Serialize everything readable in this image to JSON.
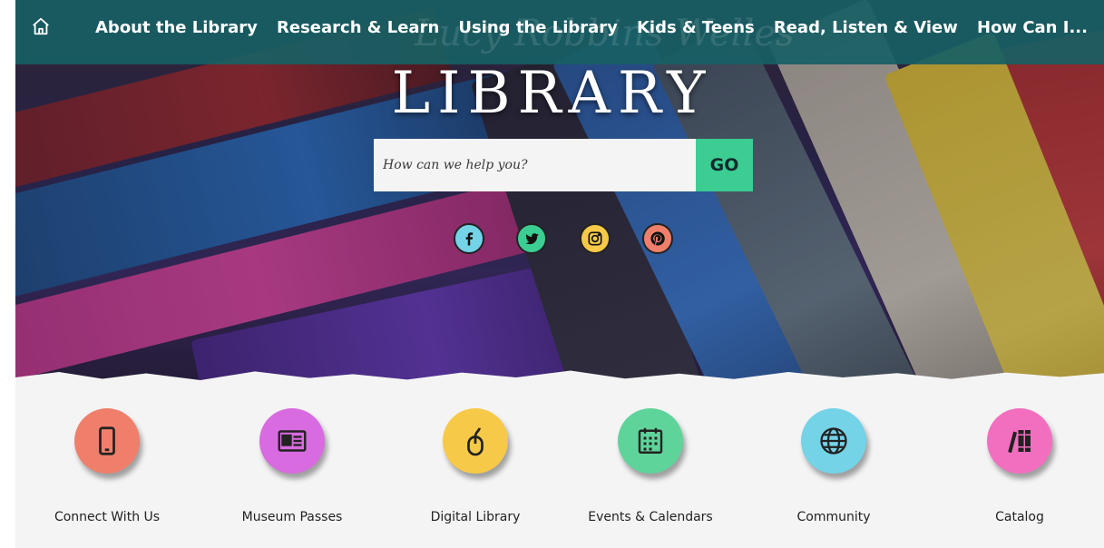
{
  "nav": {
    "home_icon": "home-icon",
    "items": [
      {
        "label": "About the Library"
      },
      {
        "label": "Research & Learn"
      },
      {
        "label": "Using the Library"
      },
      {
        "label": "Kids & Teens"
      },
      {
        "label": "Read, Listen & View"
      },
      {
        "label": "How Can I..."
      }
    ]
  },
  "hero": {
    "title": "LIBRARY",
    "watermark": "Lucy Robbins Welles"
  },
  "search": {
    "placeholder": "How can we help you?",
    "go_label": "GO"
  },
  "social": [
    {
      "icon": "facebook-icon",
      "color": "#74d3e6"
    },
    {
      "icon": "twitter-icon",
      "color": "#3ccd93"
    },
    {
      "icon": "instagram-icon",
      "color": "#f7c948"
    },
    {
      "icon": "pinterest-icon",
      "color": "#ef7f6b"
    }
  ],
  "quicklinks": [
    {
      "label": "Connect With Us",
      "icon": "phone-icon",
      "color": "#ef7f6b"
    },
    {
      "label": "Museum Passes",
      "icon": "id-card-icon",
      "color": "#d86be0"
    },
    {
      "label": "Digital Library",
      "icon": "mouse-icon",
      "color": "#f7c948"
    },
    {
      "label": "Events & Calendars",
      "icon": "calendar-icon",
      "color": "#5fd49a"
    },
    {
      "label": "Community",
      "icon": "globe-icon",
      "color": "#74d3e6"
    },
    {
      "label": "Catalog",
      "icon": "books-icon",
      "color": "#f26fbf"
    }
  ]
}
